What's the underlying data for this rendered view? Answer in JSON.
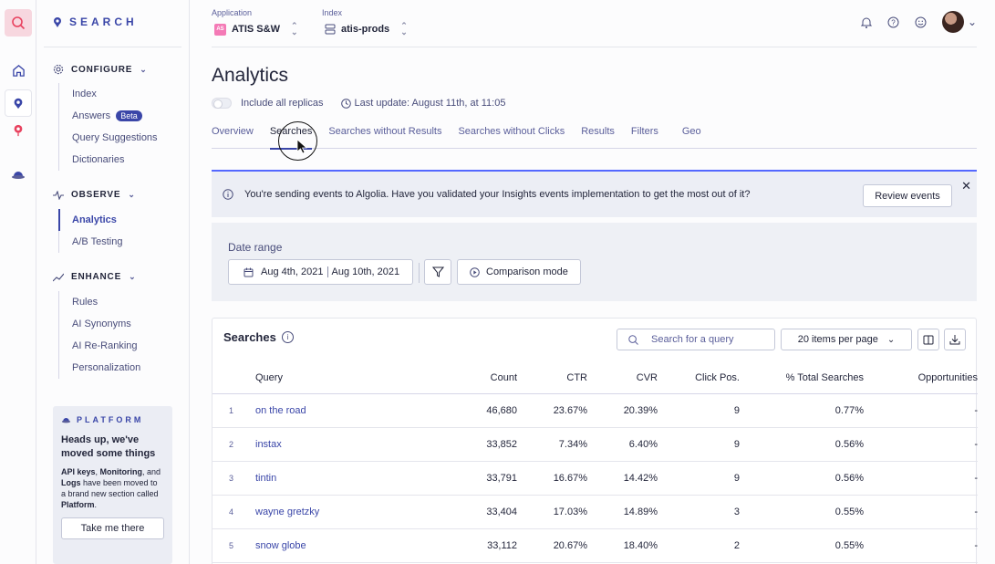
{
  "rail": {
    "icons": [
      "search-icon",
      "home-icon",
      "search-app-icon",
      "pin-icon",
      "platform-icon"
    ]
  },
  "sidebar": {
    "brand": "SEARCH",
    "sections": [
      {
        "title": "CONFIGURE",
        "items": [
          {
            "label": "Index"
          },
          {
            "label": "Answers",
            "badge": "Beta"
          },
          {
            "label": "Query Suggestions"
          },
          {
            "label": "Dictionaries"
          }
        ]
      },
      {
        "title": "OBSERVE",
        "items": [
          {
            "label": "Analytics",
            "active": true
          },
          {
            "label": "A/B Testing"
          }
        ]
      },
      {
        "title": "ENHANCE",
        "items": [
          {
            "label": "Rules"
          },
          {
            "label": "AI Synonyms"
          },
          {
            "label": "AI Re-Ranking"
          },
          {
            "label": "Personalization"
          }
        ]
      }
    ],
    "platform": {
      "header": "PLATFORM",
      "title": "Heads up, we've moved some things",
      "desc_parts": [
        "API keys",
        ", ",
        "Monitoring",
        ", and ",
        "Logs",
        " have been moved to a brand new section called ",
        "Platform",
        "."
      ],
      "button": "Take me there"
    }
  },
  "topbar": {
    "application_label": "Application",
    "application_badge": "AS",
    "application_value": "ATIS S&W",
    "index_label": "Index",
    "index_value": "atis-prods"
  },
  "page": {
    "title": "Analytics",
    "replicas_label": "Include all replicas",
    "last_update": "Last update: August 11th, at 11:05"
  },
  "tabs": [
    "Overview",
    "Searches",
    "Searches without Results",
    "Searches without Clicks",
    "Results",
    "Filters",
    "Geo"
  ],
  "active_tab": "Searches",
  "alert": {
    "message": "You're sending events to Algolia. Have you validated your Insights events implementation to get the most out of it?",
    "button": "Review events"
  },
  "date_range": {
    "label": "Date range",
    "start": "Aug 4th, 2021",
    "end": "Aug 10th, 2021",
    "comparison": "Comparison mode"
  },
  "searches_card": {
    "title": "Searches",
    "search_placeholder": "Search for a query",
    "per_page": "20 items per page",
    "columns": [
      "Query",
      "Count",
      "CTR",
      "CVR",
      "Click Pos.",
      "% Total Searches",
      "Opportunities"
    ],
    "rows": [
      {
        "rank": "1",
        "query": "on the road",
        "count": "46,680",
        "ctr": "23.67%",
        "cvr": "20.39%",
        "click_pos": "9",
        "pct_total": "0.77%",
        "opp": "-"
      },
      {
        "rank": "2",
        "query": "instax",
        "count": "33,852",
        "ctr": "7.34%",
        "cvr": "6.40%",
        "click_pos": "9",
        "pct_total": "0.56%",
        "opp": "-"
      },
      {
        "rank": "3",
        "query": "tintin",
        "count": "33,791",
        "ctr": "16.67%",
        "cvr": "14.42%",
        "click_pos": "9",
        "pct_total": "0.56%",
        "opp": "-"
      },
      {
        "rank": "4",
        "query": "wayne gretzky",
        "count": "33,404",
        "ctr": "17.03%",
        "cvr": "14.89%",
        "click_pos": "3",
        "pct_total": "0.55%",
        "opp": "-"
      },
      {
        "rank": "5",
        "query": "snow globe",
        "count": "33,112",
        "ctr": "20.67%",
        "cvr": "18.40%",
        "click_pos": "2",
        "pct_total": "0.55%",
        "opp": "-"
      }
    ]
  },
  "colors": {
    "accent": "#3a46a8",
    "alert_border": "#5468ff",
    "rail_active": "#f9dde4"
  }
}
